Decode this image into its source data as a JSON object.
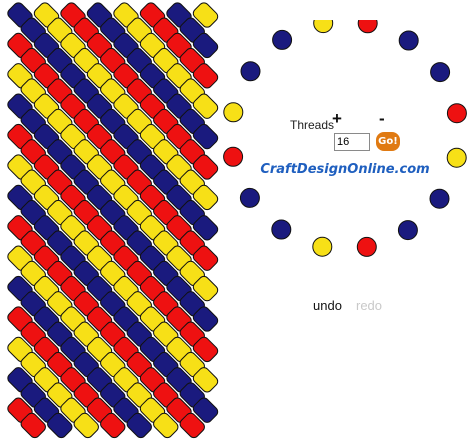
{
  "pattern": {
    "columns": 8,
    "rows": 28,
    "repeat": [
      "navy",
      "yellow",
      "red"
    ],
    "palette": {
      "navy": "#1a1a7e",
      "yellow": "#f7e017",
      "red": "#ee1111",
      "outline": "#111111"
    }
  },
  "wheel": {
    "threads": [
      "yellow",
      "red",
      "navy",
      "navy",
      "red",
      "yellow",
      "navy",
      "navy",
      "red",
      "yellow",
      "navy",
      "navy",
      "red",
      "yellow",
      "navy",
      "navy"
    ]
  },
  "controls": {
    "threads_label": "Threads",
    "plus": "+",
    "minus": "-",
    "threads_value": "16",
    "go_label": "Go!"
  },
  "watermark": "CraftDesignOnline.com",
  "history": {
    "undo": "undo",
    "redo": "redo"
  }
}
